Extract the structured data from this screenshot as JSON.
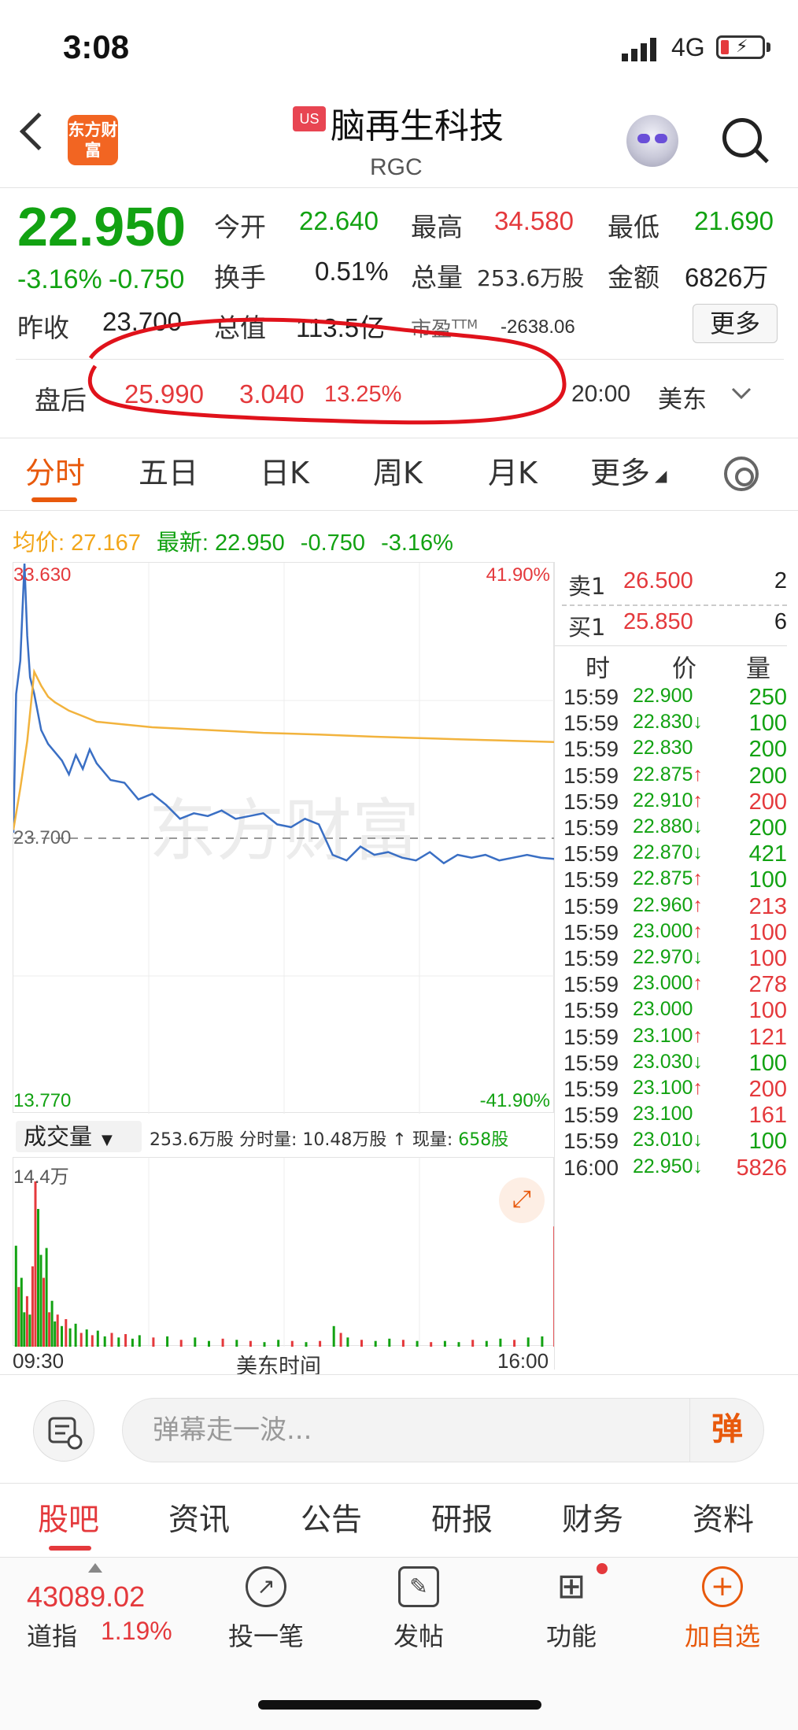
{
  "status_bar": {
    "time": "3:08",
    "network": "4G"
  },
  "header": {
    "logo_text": "东方财富",
    "market_badge": "US",
    "title": "脑再生科技",
    "ticker": "RGC"
  },
  "quote": {
    "price": "22.950",
    "change_pct": "-3.16%",
    "change": "-0.750",
    "open_label": "今开",
    "open": "22.640",
    "high_label": "最高",
    "high": "34.580",
    "low_label": "最低",
    "low": "21.690",
    "turnover_label": "换手",
    "turnover": "0.51%",
    "volume_label": "总量",
    "volume": "253.6万股",
    "amount_label": "金额",
    "amount": "6826万",
    "prev_close_label": "昨收",
    "prev_close": "23.700",
    "mktcap_label": "总值",
    "mktcap": "113.5亿",
    "pe_label": "市盈",
    "pe_suffix": "TTM",
    "pe": "-2638.06",
    "more_label": "更多"
  },
  "after_hours": {
    "label": "盘后",
    "price": "25.990",
    "change": "3.040",
    "change_pct": "13.25%",
    "time": "20:00",
    "zone": "美东"
  },
  "chart_tabs": [
    "分时",
    "五日",
    "日K",
    "周K",
    "月K",
    "更多"
  ],
  "avg_bar": {
    "avg_label": "均价:",
    "avg": "27.167",
    "last_label": "最新:",
    "last": "22.950",
    "change": "-0.750",
    "pct": "-3.16%"
  },
  "chart_data": {
    "type": "line",
    "watermark": "东方财富",
    "ylim": [
      13.77,
      33.63
    ],
    "y_top": "33.630",
    "y_mid": "23.700",
    "y_bottom": "13.770",
    "pct_top": "41.90%",
    "pct_bottom": "-41.90%",
    "x_start": "09:30",
    "x_end": "16:00",
    "x_label": "美东时间",
    "series": [
      {
        "name": "最新",
        "color": "#3a6fc4",
        "x": [
          0,
          2,
          5,
          8,
          10,
          12,
          15,
          20,
          25,
          30,
          35,
          40,
          45,
          50,
          55,
          60,
          70,
          80,
          90,
          100,
          110,
          120,
          130,
          140,
          150,
          160,
          170,
          180,
          190,
          200,
          210,
          220,
          230,
          240,
          250,
          260,
          270,
          280,
          290,
          300,
          310,
          320,
          330,
          340,
          350,
          360,
          370,
          380,
          390
        ],
        "values": [
          23.9,
          28.9,
          30.1,
          33.6,
          31.0,
          29.5,
          28.9,
          27.6,
          27.1,
          26.8,
          26.5,
          26.0,
          26.7,
          26.2,
          26.9,
          26.4,
          25.8,
          25.7,
          25.1,
          25.3,
          24.9,
          24.4,
          24.6,
          24.5,
          24.7,
          24.4,
          24.5,
          24.6,
          24.2,
          24.1,
          24.4,
          24.2,
          23.1,
          22.9,
          23.4,
          23.1,
          23.2,
          23.0,
          22.9,
          23.2,
          22.8,
          23.1,
          23.0,
          23.1,
          22.9,
          23.0,
          23.1,
          23.0,
          22.95
        ]
      },
      {
        "name": "均价",
        "color": "#f2b33d",
        "x": [
          0,
          5,
          10,
          15,
          20,
          25,
          30,
          40,
          50,
          60,
          80,
          100,
          120,
          140,
          160,
          180,
          200,
          220,
          240,
          260,
          280,
          300,
          320,
          340,
          360,
          380,
          390
        ],
        "values": [
          24.0,
          25.5,
          27.2,
          29.7,
          29.2,
          28.8,
          28.6,
          28.3,
          28.1,
          27.9,
          27.8,
          27.7,
          27.65,
          27.6,
          27.55,
          27.5,
          27.47,
          27.44,
          27.4,
          27.36,
          27.33,
          27.3,
          27.27,
          27.24,
          27.21,
          27.18,
          27.17
        ]
      }
    ]
  },
  "volume": {
    "selector": "成交量",
    "total": "253.6万股",
    "minute_vol_label": "分时量:",
    "minute_vol": "10.48万股",
    "arrow": "↑",
    "current_label": "现量:",
    "current": "658股",
    "max_label": "14.4万",
    "max": 144000,
    "bars": [
      {
        "t": 1,
        "v": 88000,
        "c": "g"
      },
      {
        "t": 3,
        "v": 52000,
        "c": "r"
      },
      {
        "t": 5,
        "v": 60000,
        "c": "g"
      },
      {
        "t": 7,
        "v": 30000,
        "c": "g"
      },
      {
        "t": 9,
        "v": 44000,
        "c": "r"
      },
      {
        "t": 11,
        "v": 28000,
        "c": "g"
      },
      {
        "t": 13,
        "v": 70000,
        "c": "r"
      },
      {
        "t": 15,
        "v": 144000,
        "c": "r"
      },
      {
        "t": 17,
        "v": 120000,
        "c": "g"
      },
      {
        "t": 19,
        "v": 80000,
        "c": "g"
      },
      {
        "t": 21,
        "v": 60000,
        "c": "r"
      },
      {
        "t": 23,
        "v": 86000,
        "c": "g"
      },
      {
        "t": 25,
        "v": 30000,
        "c": "r"
      },
      {
        "t": 27,
        "v": 40000,
        "c": "g"
      },
      {
        "t": 29,
        "v": 22000,
        "c": "g"
      },
      {
        "t": 31,
        "v": 28000,
        "c": "r"
      },
      {
        "t": 34,
        "v": 18000,
        "c": "g"
      },
      {
        "t": 37,
        "v": 24000,
        "c": "r"
      },
      {
        "t": 40,
        "v": 16000,
        "c": "g"
      },
      {
        "t": 44,
        "v": 20000,
        "c": "g"
      },
      {
        "t": 48,
        "v": 12000,
        "c": "r"
      },
      {
        "t": 52,
        "v": 15000,
        "c": "g"
      },
      {
        "t": 56,
        "v": 10000,
        "c": "r"
      },
      {
        "t": 60,
        "v": 14000,
        "c": "g"
      },
      {
        "t": 65,
        "v": 9000,
        "c": "g"
      },
      {
        "t": 70,
        "v": 12000,
        "c": "r"
      },
      {
        "t": 75,
        "v": 8000,
        "c": "g"
      },
      {
        "t": 80,
        "v": 11000,
        "c": "r"
      },
      {
        "t": 85,
        "v": 7000,
        "c": "g"
      },
      {
        "t": 90,
        "v": 10000,
        "c": "g"
      },
      {
        "t": 100,
        "v": 8000,
        "c": "r"
      },
      {
        "t": 110,
        "v": 9000,
        "c": "g"
      },
      {
        "t": 120,
        "v": 6000,
        "c": "r"
      },
      {
        "t": 130,
        "v": 8000,
        "c": "g"
      },
      {
        "t": 140,
        "v": 5000,
        "c": "g"
      },
      {
        "t": 150,
        "v": 7000,
        "c": "r"
      },
      {
        "t": 160,
        "v": 6000,
        "c": "g"
      },
      {
        "t": 170,
        "v": 5000,
        "c": "r"
      },
      {
        "t": 180,
        "v": 4000,
        "c": "g"
      },
      {
        "t": 190,
        "v": 6000,
        "c": "g"
      },
      {
        "t": 200,
        "v": 5000,
        "c": "r"
      },
      {
        "t": 210,
        "v": 4000,
        "c": "g"
      },
      {
        "t": 220,
        "v": 5000,
        "c": "r"
      },
      {
        "t": 230,
        "v": 18000,
        "c": "g"
      },
      {
        "t": 235,
        "v": 12000,
        "c": "r"
      },
      {
        "t": 240,
        "v": 8000,
        "c": "g"
      },
      {
        "t": 250,
        "v": 6000,
        "c": "r"
      },
      {
        "t": 260,
        "v": 5000,
        "c": "g"
      },
      {
        "t": 270,
        "v": 7000,
        "c": "g"
      },
      {
        "t": 280,
        "v": 6000,
        "c": "r"
      },
      {
        "t": 290,
        "v": 5000,
        "c": "g"
      },
      {
        "t": 300,
        "v": 4000,
        "c": "r"
      },
      {
        "t": 310,
        "v": 5000,
        "c": "g"
      },
      {
        "t": 320,
        "v": 4000,
        "c": "g"
      },
      {
        "t": 330,
        "v": 6000,
        "c": "r"
      },
      {
        "t": 340,
        "v": 5000,
        "c": "g"
      },
      {
        "t": 350,
        "v": 7000,
        "c": "g"
      },
      {
        "t": 360,
        "v": 6000,
        "c": "r"
      },
      {
        "t": 370,
        "v": 8000,
        "c": "g"
      },
      {
        "t": 380,
        "v": 9000,
        "c": "g"
      },
      {
        "t": 389,
        "v": 104800,
        "c": "r"
      }
    ]
  },
  "orderbook": {
    "ask_label": "卖1",
    "ask_price": "26.500",
    "ask_qty": "2",
    "bid_label": "买1",
    "bid_price": "25.850",
    "bid_qty": "6",
    "col_time": "时",
    "col_price": "价",
    "col_qty": "量"
  },
  "trades": [
    {
      "time": "15:59",
      "price": "22.900",
      "dir": "",
      "qty": "250",
      "qc": "g"
    },
    {
      "time": "15:59",
      "price": "22.830",
      "dir": "↓",
      "qty": "100",
      "qc": "g"
    },
    {
      "time": "15:59",
      "price": "22.830",
      "dir": "",
      "qty": "200",
      "qc": "g"
    },
    {
      "time": "15:59",
      "price": "22.875",
      "dir": "↑",
      "qty": "200",
      "qc": "g"
    },
    {
      "time": "15:59",
      "price": "22.910",
      "dir": "↑",
      "qty": "200",
      "qc": "r"
    },
    {
      "time": "15:59",
      "price": "22.880",
      "dir": "↓",
      "qty": "200",
      "qc": "g"
    },
    {
      "time": "15:59",
      "price": "22.870",
      "dir": "↓",
      "qty": "421",
      "qc": "g"
    },
    {
      "time": "15:59",
      "price": "22.875",
      "dir": "↑",
      "qty": "100",
      "qc": "g"
    },
    {
      "time": "15:59",
      "price": "22.960",
      "dir": "↑",
      "qty": "213",
      "qc": "r"
    },
    {
      "time": "15:59",
      "price": "23.000",
      "dir": "↑",
      "qty": "100",
      "qc": "r"
    },
    {
      "time": "15:59",
      "price": "22.970",
      "dir": "↓",
      "qty": "100",
      "qc": "r"
    },
    {
      "time": "15:59",
      "price": "23.000",
      "dir": "↑",
      "qty": "278",
      "qc": "r"
    },
    {
      "time": "15:59",
      "price": "23.000",
      "dir": "",
      "qty": "100",
      "qc": "r"
    },
    {
      "time": "15:59",
      "price": "23.100",
      "dir": "↑",
      "qty": "121",
      "qc": "r"
    },
    {
      "time": "15:59",
      "price": "23.030",
      "dir": "↓",
      "qty": "100",
      "qc": "g"
    },
    {
      "time": "15:59",
      "price": "23.100",
      "dir": "↑",
      "qty": "200",
      "qc": "r"
    },
    {
      "time": "15:59",
      "price": "23.100",
      "dir": "",
      "qty": "161",
      "qc": "r"
    },
    {
      "time": "15:59",
      "price": "23.010",
      "dir": "↓",
      "qty": "100",
      "qc": "g"
    },
    {
      "time": "16:00",
      "price": "22.950",
      "dir": "↓",
      "qty": "5826",
      "qc": "r"
    }
  ],
  "comment": {
    "placeholder": "弹幕走一波...",
    "danmu_label": "弹"
  },
  "sub_tabs": [
    "股吧",
    "资讯",
    "公告",
    "研报",
    "财务",
    "资料"
  ],
  "bottom_nav": {
    "index_value": "43089.02",
    "index_name": "道指",
    "index_pct": "1.19%",
    "items": [
      "投一笔",
      "发帖",
      "功能",
      "加自选"
    ]
  }
}
